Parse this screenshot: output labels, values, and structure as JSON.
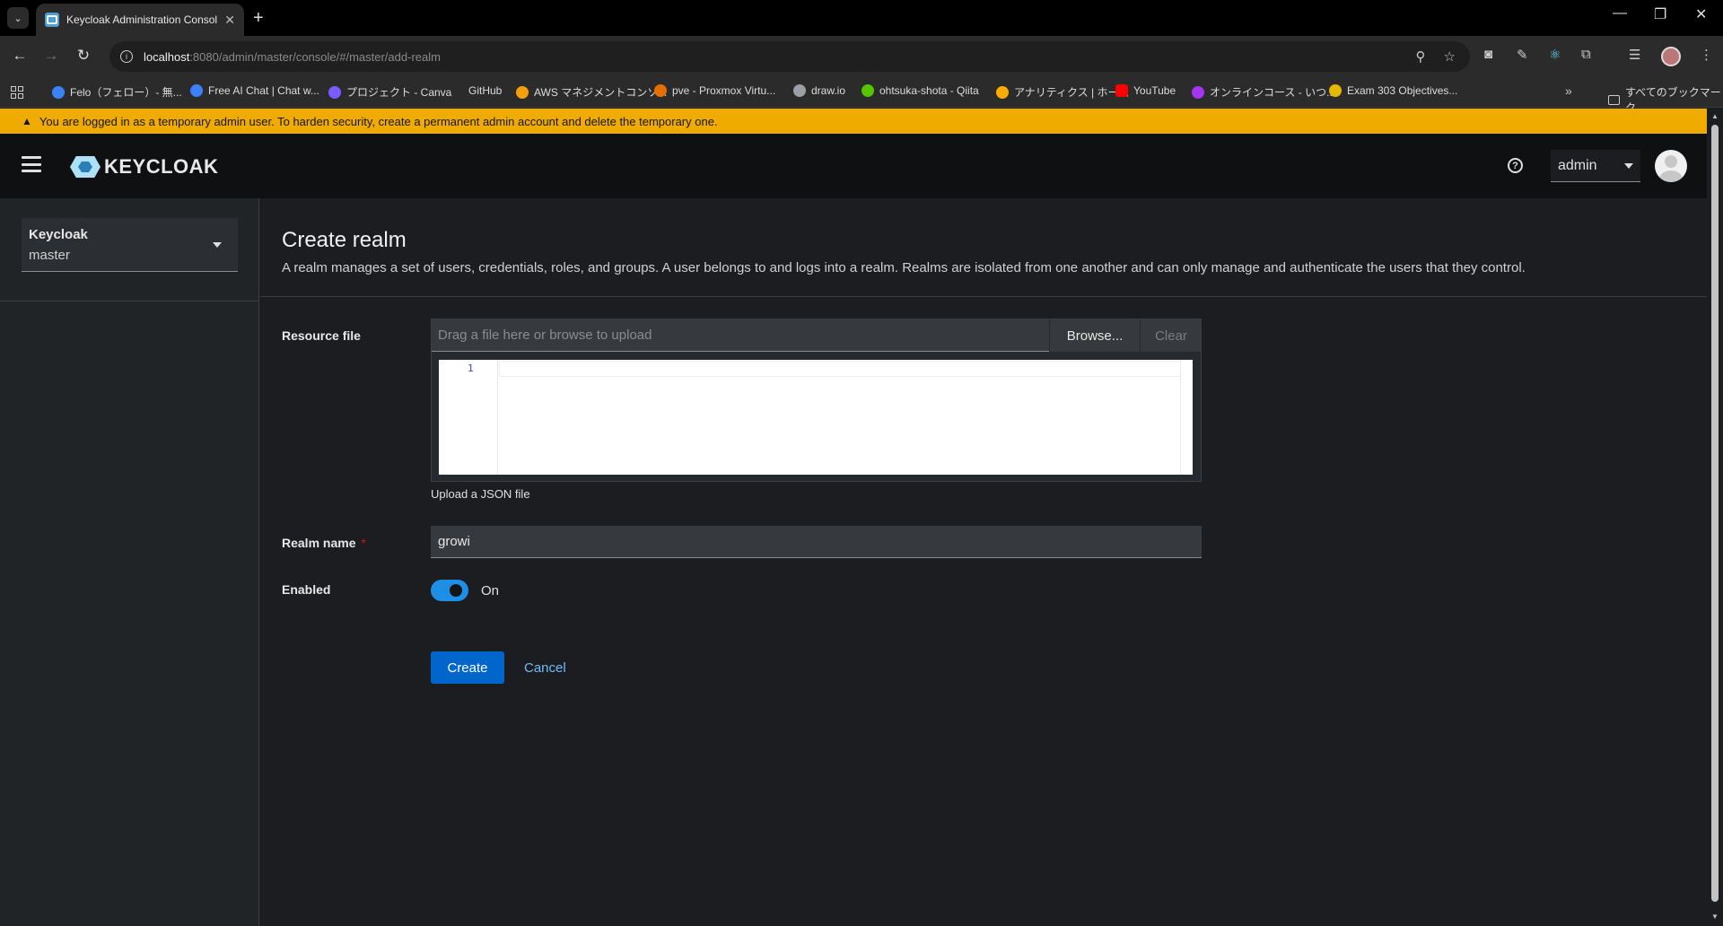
{
  "browser": {
    "tab_title": "Keycloak Administration Console",
    "url_host": "localhost",
    "url_rest": ":8080/admin/master/console/#/master/add-realm",
    "bookmarks": [
      {
        "label": "Felo（フェロー）- 無...",
        "color": "#3b82f6"
      },
      {
        "label": "Free AI Chat | Chat w...",
        "color": "#3b82f6"
      },
      {
        "label": "プロジェクト - Canva",
        "color": "#7c5cff"
      },
      {
        "label": "GitHub",
        "color": "#2b2b2b"
      },
      {
        "label": "AWS マネジメントコンソ...",
        "color": "#f59e0b"
      },
      {
        "label": "pve - Proxmox Virtu...",
        "color": "#e57000"
      },
      {
        "label": "draw.io",
        "color": "#9aa0a6"
      },
      {
        "label": "ohtsuka-shota - Qiita",
        "color": "#55c500"
      },
      {
        "label": "アナリティクス | ホーム",
        "color": "#f9ab00"
      },
      {
        "label": "YouTube",
        "color": "#ff0000"
      },
      {
        "label": "オンラインコース - いつ...",
        "color": "#a435f0"
      },
      {
        "label": "Exam 303 Objectives...",
        "color": "#e5b800"
      }
    ],
    "all_bookmarks": "すべてのブックマーク"
  },
  "alert": {
    "text": "You are logged in as a temporary admin user. To harden security, create a permanent admin account and delete the temporary one."
  },
  "header": {
    "logo_text": "KEYCLOAK",
    "user": "admin"
  },
  "sidebar": {
    "realm_title": "Keycloak",
    "realm_name": "master"
  },
  "page": {
    "title": "Create realm",
    "description": "A realm manages a set of users, credentials, roles, and groups. A user belongs to and logs into a realm. Realms are isolated from one another and can only manage and authenticate the users that they control."
  },
  "form": {
    "resource_file_label": "Resource file",
    "file_placeholder": "Drag a file here or browse to upload",
    "browse_label": "Browse...",
    "clear_label": "Clear",
    "editor_line": "1",
    "helper_text": "Upload a JSON file",
    "realm_name_label": "Realm name",
    "required_mark": "*",
    "realm_name_value": "growi",
    "enabled_label": "Enabled",
    "enabled_state": "On",
    "create_label": "Create",
    "cancel_label": "Cancel"
  },
  "colors": {
    "alert": "#f0ab00",
    "primary": "#0066cc",
    "switch_on": "#1e8fe6",
    "link": "#73bcf7"
  }
}
